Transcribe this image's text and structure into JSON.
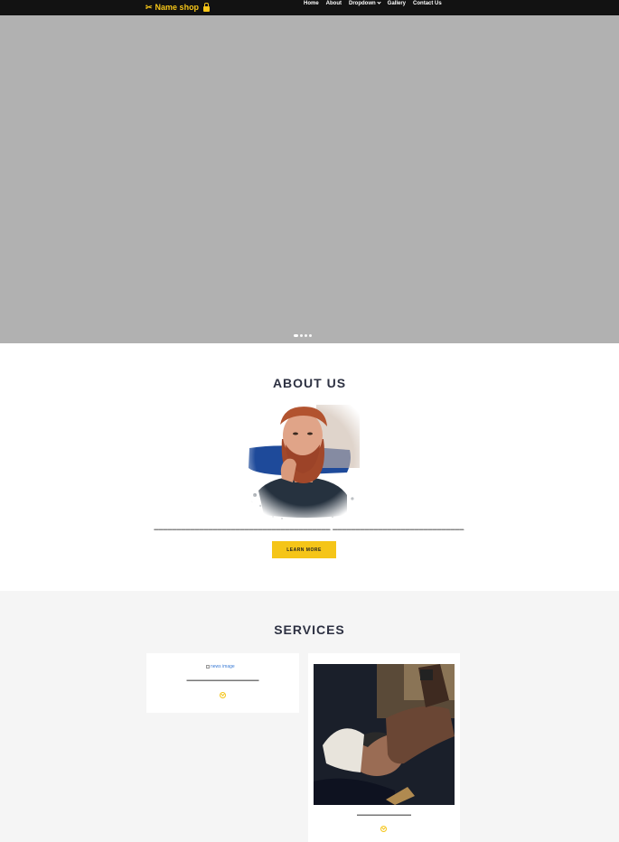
{
  "navbar": {
    "brand": "Name shop",
    "brand_icon": "scissors-icon",
    "links": [
      {
        "label": "Home"
      },
      {
        "label": "About"
      },
      {
        "label": "Dropdown"
      },
      {
        "label": "Gallery"
      },
      {
        "label": "Contact Us"
      }
    ]
  },
  "hero": {
    "slide_count": 4,
    "active_slide": 1
  },
  "about": {
    "title": "ABOUT US",
    "text": "▬▬▬▬▬▬▬▬▬▬▬▬▬▬▬▬▬▬▬▬▬▬▬▬▬▬▬▬▬▬▬▬▬▬▬▬▬▬▬. ▬▬▬▬▬▬▬▬▬▬▬▬▬▬▬▬▬▬▬▬▬▬▬▬▬▬▬▬▬.",
    "button_label": "LEARN MORE"
  },
  "services": {
    "title": "SERVICES",
    "cards": [
      {
        "image_alt": "news image",
        "text": "▬▬▬▬▬▬▬▬▬▬▬▬▬▬▬▬"
      },
      {
        "text": "▬▬▬▬▬▬▬▬▬▬▬▬"
      }
    ]
  },
  "colors": {
    "accent": "#f5c518",
    "navbar_bg": "#121212",
    "hero_bg": "#b1b1b1",
    "heading": "#2d3142",
    "services_bg": "#f5f5f5"
  }
}
